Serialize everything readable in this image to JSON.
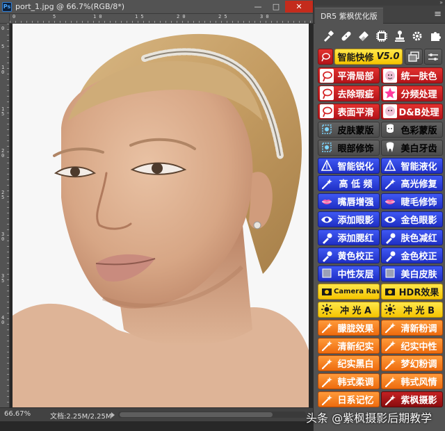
{
  "document": {
    "title": "port_1.jpg @ 66.7%(RGB/8*)",
    "app_badge": "Ps",
    "window_controls": {
      "minimize": "—",
      "maximize": "□",
      "close": "✕"
    },
    "ruler_top_numbers": [
      "0",
      "5",
      "1 0",
      "1 5",
      "2 0",
      "2 5",
      "3 0"
    ],
    "ruler_left_numbers": [
      "0",
      "5",
      "1 0",
      "1 5",
      "2 0",
      "2 5",
      "3 0",
      "3 5",
      "4 0"
    ],
    "photo_subject": "portrait-woman-headband",
    "status": {
      "zoom": "66.67%",
      "doc_info": "文档:2.25M/2.25M"
    }
  },
  "panel": {
    "tab_title": "DR5 紫枫优化版",
    "collapse_glyph": "»",
    "menu_glyph": "≡",
    "tool_icons": [
      "eyedropper-icon",
      "bandage-icon",
      "eraser-icon",
      "chip-icon",
      "stamp-icon",
      "gear-icon",
      "puzzle-icon"
    ],
    "v50": {
      "label": "智能快修",
      "version": "V5.0"
    },
    "rows": [
      {
        "l": "平滑局部",
        "r": "统一肤色"
      },
      {
        "l": "去除瑕疵",
        "r": "分频处理"
      },
      {
        "l": "表面平滑",
        "r": "D&B处理"
      },
      {
        "l": "皮肤蒙版",
        "r": "色彩蒙版"
      },
      {
        "l": "眼部修饰",
        "r": "美白牙齿"
      },
      {
        "l": "智能锐化",
        "r": "智能液化"
      },
      {
        "l": "高 低 频",
        "r": "高光修复"
      },
      {
        "l": "嘴唇增强",
        "r": "睫毛修饰"
      },
      {
        "l": "添加眼影",
        "r": "金色眼影"
      },
      {
        "l": "添加腮红",
        "r": "肤色减红"
      },
      {
        "l": "黄色校正",
        "r": "金色校正"
      },
      {
        "l": "中性灰层",
        "r": "美白皮肤"
      },
      {
        "l": "Camera Raw",
        "r": "HDR效果"
      },
      {
        "l": "冲 光 A",
        "r": "冲 光 B"
      },
      {
        "l": "朦胧效果",
        "r": "清新粉调"
      },
      {
        "l": "清新纪实",
        "r": "纪实中性"
      },
      {
        "l": "纪实黑白",
        "r": "梦幻粉调"
      },
      {
        "l": "韩式柔调",
        "r": "韩式风情"
      },
      {
        "l": "日系记忆",
        "r": "紫枫摄影"
      }
    ]
  },
  "watermark": "头条 @紫枫摄影后期教学",
  "colors": {
    "panel_bg": "#535353",
    "red": "#d42527",
    "blue": "#2b3fe0",
    "yellow": "#f9d20f",
    "orange": "#f57c1f",
    "dark_red": "#a3161a"
  }
}
